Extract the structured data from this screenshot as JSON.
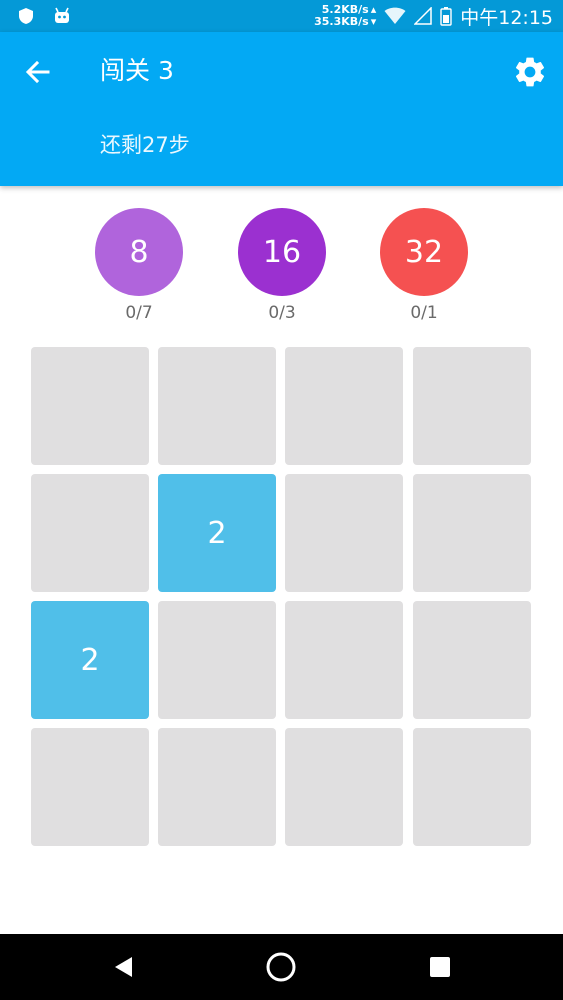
{
  "status_bar": {
    "icons": [
      "shield-icon",
      "android-robot-icon",
      "wifi-icon",
      "signal-icon",
      "battery-icon"
    ],
    "net_up": "5.2KB/s",
    "net_down": "35.3KB/s",
    "time": "中午12:15"
  },
  "header": {
    "title": "闯关 3",
    "subtitle": "还剩27步",
    "back_icon": "arrow-back-icon",
    "settings_icon": "gear-icon"
  },
  "goals": [
    {
      "value": "8",
      "progress": "0/7",
      "color": "#b064dc"
    },
    {
      "value": "16",
      "progress": "0/3",
      "color": "#9b30d0"
    },
    {
      "value": "32",
      "progress": "0/1",
      "color": "#f55151"
    }
  ],
  "board": {
    "rows": [
      [
        "",
        "",
        "",
        ""
      ],
      [
        "",
        "2",
        "",
        ""
      ],
      [
        "2",
        "",
        "",
        ""
      ],
      [
        "",
        "",
        "",
        ""
      ]
    ],
    "empty_color": "#e0dfe0",
    "tile_color": "#50bfe9"
  },
  "nav_bar": {
    "icons": [
      "back-triangle-icon",
      "home-circle-icon",
      "recents-square-icon"
    ]
  }
}
